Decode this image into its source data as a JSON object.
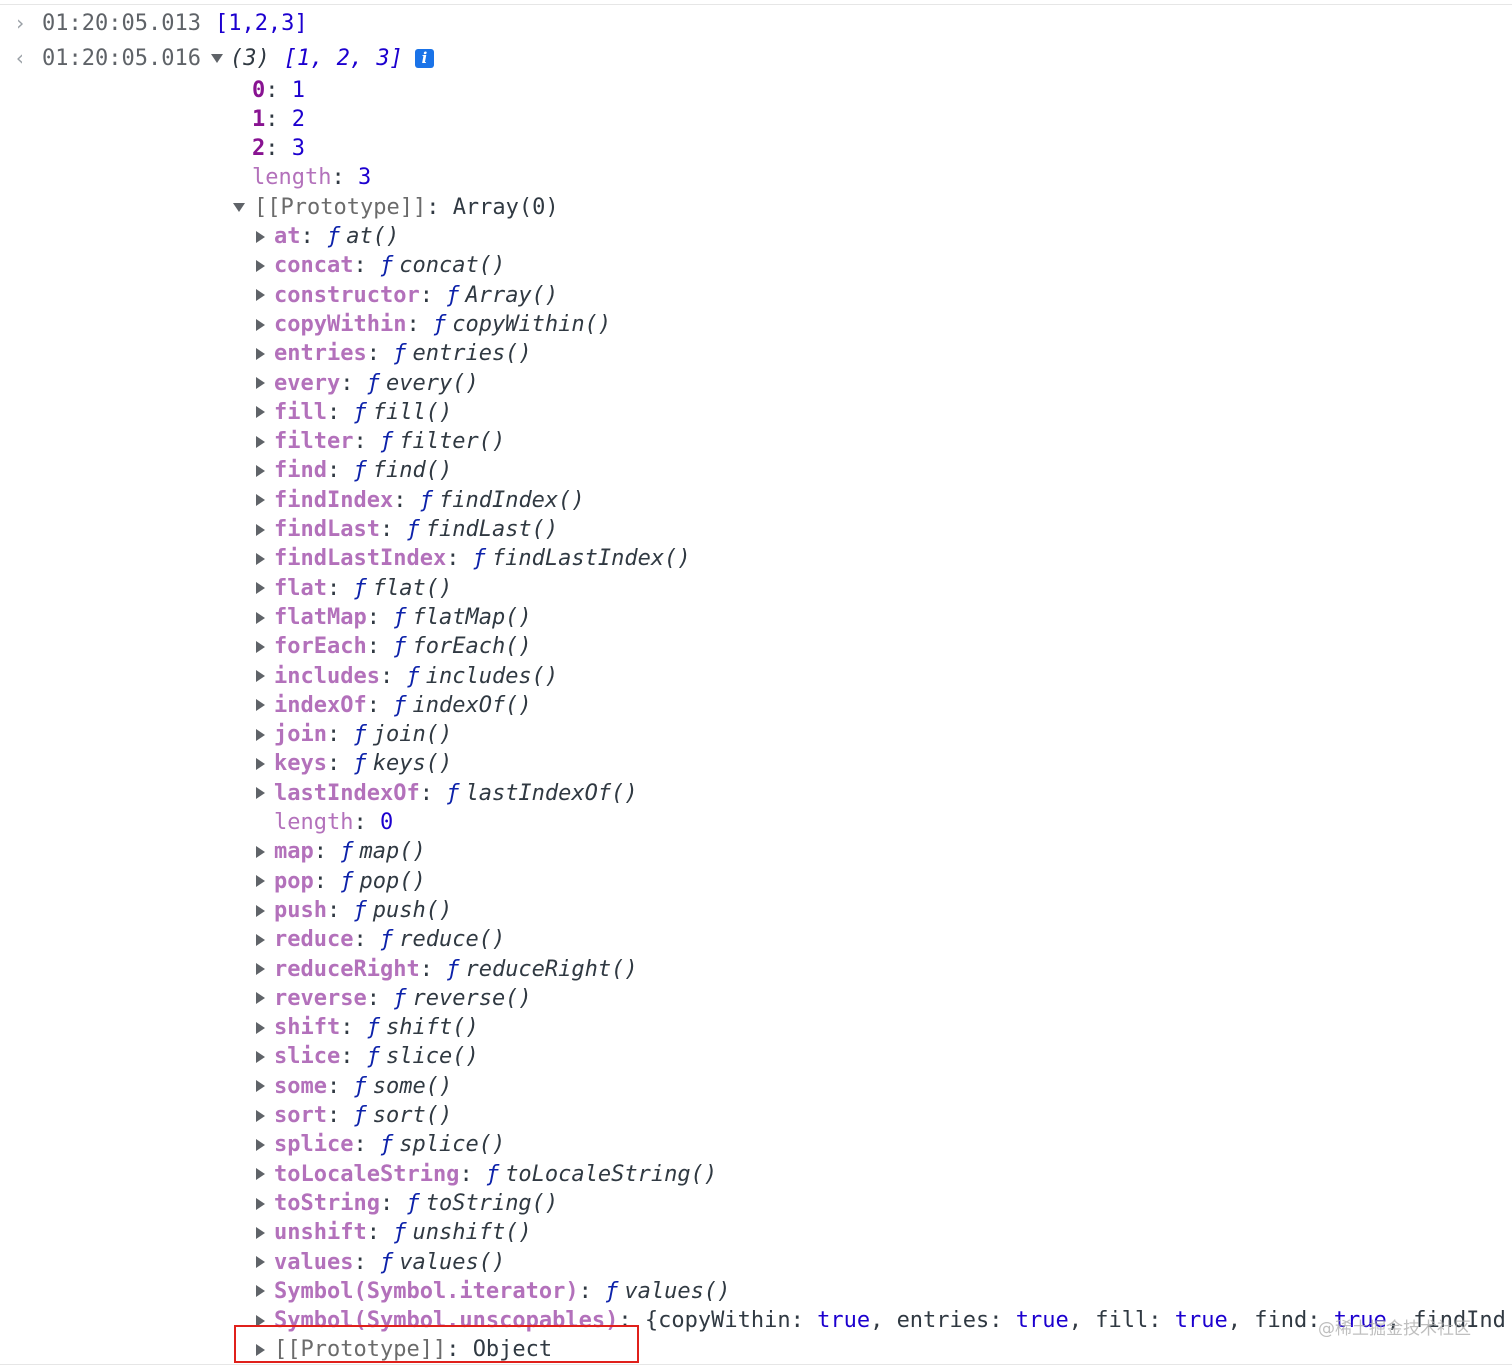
{
  "console": {
    "input": {
      "prompt_icon": "chevron-right-icon",
      "timestamp": "01:20:05.013",
      "text": "[1,2,3]"
    },
    "output": {
      "return_icon": "chevron-left-icon",
      "timestamp": "01:20:05.016",
      "summary_count": "(3)",
      "summary_values": "[1, 2, 3]",
      "info_badge": "i",
      "entries": [
        {
          "key": "0",
          "value": "1"
        },
        {
          "key": "1",
          "value": "2"
        },
        {
          "key": "2",
          "value": "3"
        }
      ],
      "length": {
        "key": "length",
        "value": "3"
      },
      "prototype": {
        "key": "[[Prototype]]",
        "value": "Array(0)",
        "members": [
          {
            "key": "at",
            "f": "ƒ",
            "fn": "at()"
          },
          {
            "key": "concat",
            "f": "ƒ",
            "fn": "concat()"
          },
          {
            "key": "constructor",
            "f": "ƒ",
            "fn": "Array()"
          },
          {
            "key": "copyWithin",
            "f": "ƒ",
            "fn": "copyWithin()"
          },
          {
            "key": "entries",
            "f": "ƒ",
            "fn": "entries()"
          },
          {
            "key": "every",
            "f": "ƒ",
            "fn": "every()"
          },
          {
            "key": "fill",
            "f": "ƒ",
            "fn": "fill()"
          },
          {
            "key": "filter",
            "f": "ƒ",
            "fn": "filter()"
          },
          {
            "key": "find",
            "f": "ƒ",
            "fn": "find()"
          },
          {
            "key": "findIndex",
            "f": "ƒ",
            "fn": "findIndex()"
          },
          {
            "key": "findLast",
            "f": "ƒ",
            "fn": "findLast()"
          },
          {
            "key": "findLastIndex",
            "f": "ƒ",
            "fn": "findLastIndex()"
          },
          {
            "key": "flat",
            "f": "ƒ",
            "fn": "flat()"
          },
          {
            "key": "flatMap",
            "f": "ƒ",
            "fn": "flatMap()"
          },
          {
            "key": "forEach",
            "f": "ƒ",
            "fn": "forEach()"
          },
          {
            "key": "includes",
            "f": "ƒ",
            "fn": "includes()"
          },
          {
            "key": "indexOf",
            "f": "ƒ",
            "fn": "indexOf()"
          },
          {
            "key": "join",
            "f": "ƒ",
            "fn": "join()"
          },
          {
            "key": "keys",
            "f": "ƒ",
            "fn": "keys()"
          },
          {
            "key": "lastIndexOf",
            "f": "ƒ",
            "fn": "lastIndexOf()"
          },
          {
            "key": "length",
            "value": "0"
          },
          {
            "key": "map",
            "f": "ƒ",
            "fn": "map()"
          },
          {
            "key": "pop",
            "f": "ƒ",
            "fn": "pop()"
          },
          {
            "key": "push",
            "f": "ƒ",
            "fn": "push()"
          },
          {
            "key": "reduce",
            "f": "ƒ",
            "fn": "reduce()"
          },
          {
            "key": "reduceRight",
            "f": "ƒ",
            "fn": "reduceRight()"
          },
          {
            "key": "reverse",
            "f": "ƒ",
            "fn": "reverse()"
          },
          {
            "key": "shift",
            "f": "ƒ",
            "fn": "shift()"
          },
          {
            "key": "slice",
            "f": "ƒ",
            "fn": "slice()"
          },
          {
            "key": "some",
            "f": "ƒ",
            "fn": "some()"
          },
          {
            "key": "sort",
            "f": "ƒ",
            "fn": "sort()"
          },
          {
            "key": "splice",
            "f": "ƒ",
            "fn": "splice()"
          },
          {
            "key": "toLocaleString",
            "f": "ƒ",
            "fn": "toLocaleString()"
          },
          {
            "key": "toString",
            "f": "ƒ",
            "fn": "toString()"
          },
          {
            "key": "unshift",
            "f": "ƒ",
            "fn": "unshift()"
          },
          {
            "key": "values",
            "f": "ƒ",
            "fn": "values()"
          },
          {
            "key": "Symbol(Symbol.iterator)",
            "f": "ƒ",
            "fn": "values()"
          },
          {
            "key": "Symbol(Symbol.unscopables)",
            "object_preview": [
              {
                "k": "{copyWithin",
                "v": "true"
              },
              {
                "k": "entries",
                "v": "true"
              },
              {
                "k": "fill",
                "v": "true"
              },
              {
                "k": "find",
                "v": "true"
              },
              {
                "k": "findInd",
                "v": ""
              }
            ]
          },
          {
            "key": "[[Prototype]]",
            "value": "Object",
            "highlighted": true
          }
        ]
      }
    }
  },
  "watermark": "@稀土掘金技术社区",
  "colors": {
    "highlight_border": "#e0201b",
    "key_purple": "#b371bb",
    "index_purple": "#881391",
    "number_blue": "#1c00cf"
  }
}
